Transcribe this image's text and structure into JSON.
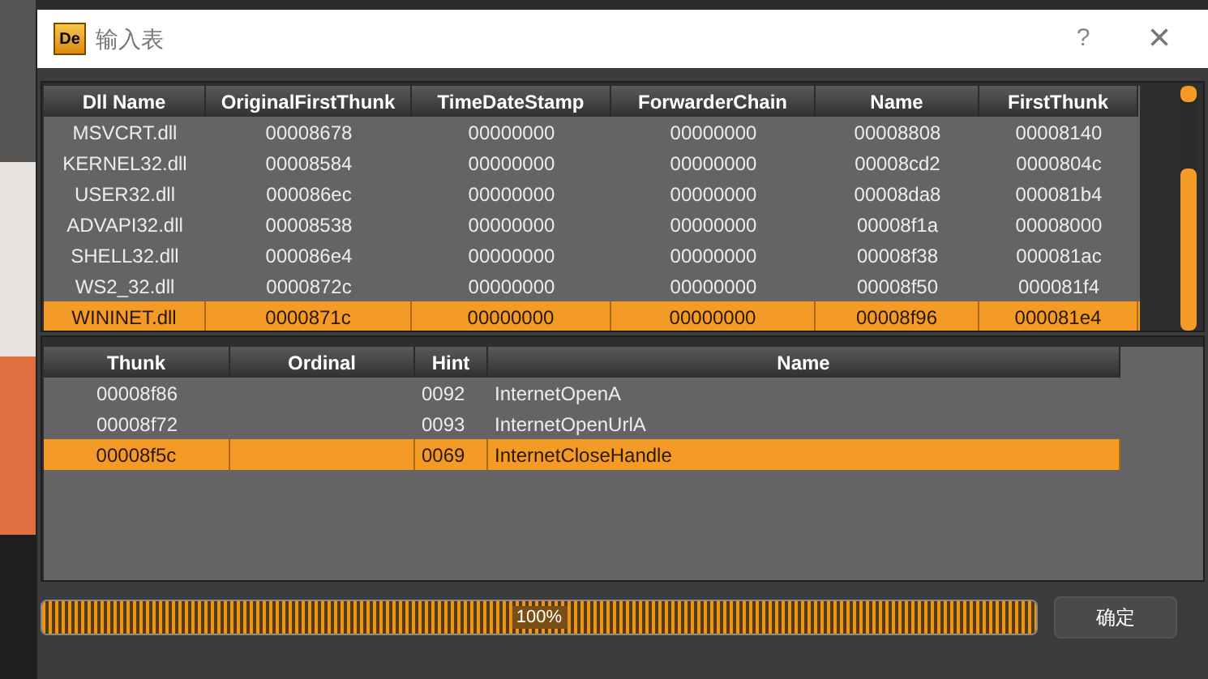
{
  "window": {
    "title": "输入表",
    "app_icon": "De",
    "help": "?",
    "close": "×"
  },
  "dll_table": {
    "columns": [
      "Dll Name",
      "OriginalFirstThunk",
      "TimeDateStamp",
      "ForwarderChain",
      "Name",
      "FirstThunk"
    ],
    "rows": [
      {
        "cells": [
          "MSVCRT.dll",
          "00008678",
          "00000000",
          "00000000",
          "00008808",
          "00008140"
        ],
        "selected": false
      },
      {
        "cells": [
          "KERNEL32.dll",
          "00008584",
          "00000000",
          "00000000",
          "00008cd2",
          "0000804c"
        ],
        "selected": false
      },
      {
        "cells": [
          "USER32.dll",
          "000086ec",
          "00000000",
          "00000000",
          "00008da8",
          "000081b4"
        ],
        "selected": false
      },
      {
        "cells": [
          "ADVAPI32.dll",
          "00008538",
          "00000000",
          "00000000",
          "00008f1a",
          "00008000"
        ],
        "selected": false
      },
      {
        "cells": [
          "SHELL32.dll",
          "000086e4",
          "00000000",
          "00000000",
          "00008f38",
          "000081ac"
        ],
        "selected": false
      },
      {
        "cells": [
          "WS2_32.dll",
          "0000872c",
          "00000000",
          "00000000",
          "00008f50",
          "000081f4"
        ],
        "selected": false
      },
      {
        "cells": [
          "WININET.dll",
          "0000871c",
          "00000000",
          "00000000",
          "00008f96",
          "000081e4"
        ],
        "selected": true
      }
    ]
  },
  "function_table": {
    "columns": [
      "Thunk",
      "Ordinal",
      "Hint",
      "Name"
    ],
    "rows": [
      {
        "cells": [
          "00008f86",
          "",
          "0092",
          "InternetOpenA"
        ],
        "selected": false
      },
      {
        "cells": [
          "00008f72",
          "",
          "0093",
          "InternetOpenUrlA"
        ],
        "selected": false
      },
      {
        "cells": [
          "00008f5c",
          "",
          "0069",
          "InternetCloseHandle"
        ],
        "selected": true
      }
    ]
  },
  "progress": {
    "level": 1,
    "label": "100%"
  },
  "ok_button": "确定"
}
